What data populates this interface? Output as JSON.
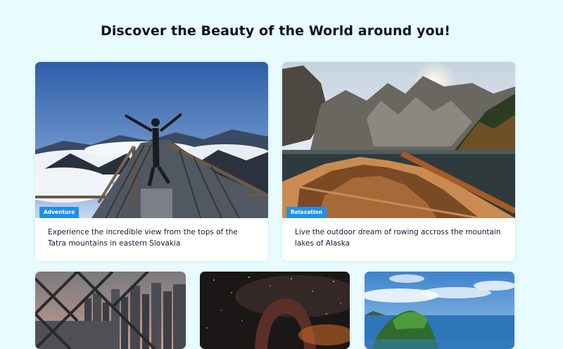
{
  "heading": "Discover the Beauty of the World around you!",
  "cards": [
    {
      "category": "Adventure",
      "description": "Experience the incredible view from the tops of the Tatra mountains in eastern Slovakia"
    },
    {
      "category": "Relaxation",
      "description": "Live the outdoor dream of rowing accross the mountain lakes of Alaska"
    }
  ],
  "colors": {
    "background": "#e8fbff",
    "badge": "#1f8fe8"
  }
}
